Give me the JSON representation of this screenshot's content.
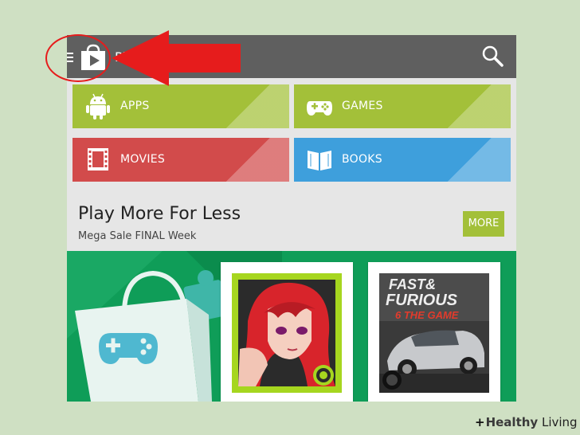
{
  "topbar": {
    "title": "Pl",
    "menu_icon": "hamburger-icon",
    "logo_icon": "play-store-bag-icon",
    "search_icon": "search-icon"
  },
  "categories": [
    {
      "label": "APPS",
      "icon": "android-icon",
      "color": "#a3c039"
    },
    {
      "label": "GAMES",
      "icon": "gamepad-icon",
      "color": "#a3c039"
    },
    {
      "label": "MOVIES",
      "icon": "film-icon",
      "color": "#d24b4b"
    },
    {
      "label": "BOOKS",
      "icon": "book-icon",
      "color": "#3e9fdc"
    }
  ],
  "promo": {
    "title": "Play More For Less",
    "subtitle": "Mega Sale FINAL Week",
    "more_label": "MORE"
  },
  "featured": [
    {
      "name": "anime-game-art"
    },
    {
      "name": "Fast & Furious 6 The Game",
      "line1": "FAST&",
      "line2": "FURIOUS",
      "line3": "6 THE GAME"
    }
  ],
  "annotation": {
    "color": "#e61c1c"
  },
  "watermark": {
    "plus": "+",
    "brand_bold": "Healthy",
    "brand_rest": " Living"
  }
}
